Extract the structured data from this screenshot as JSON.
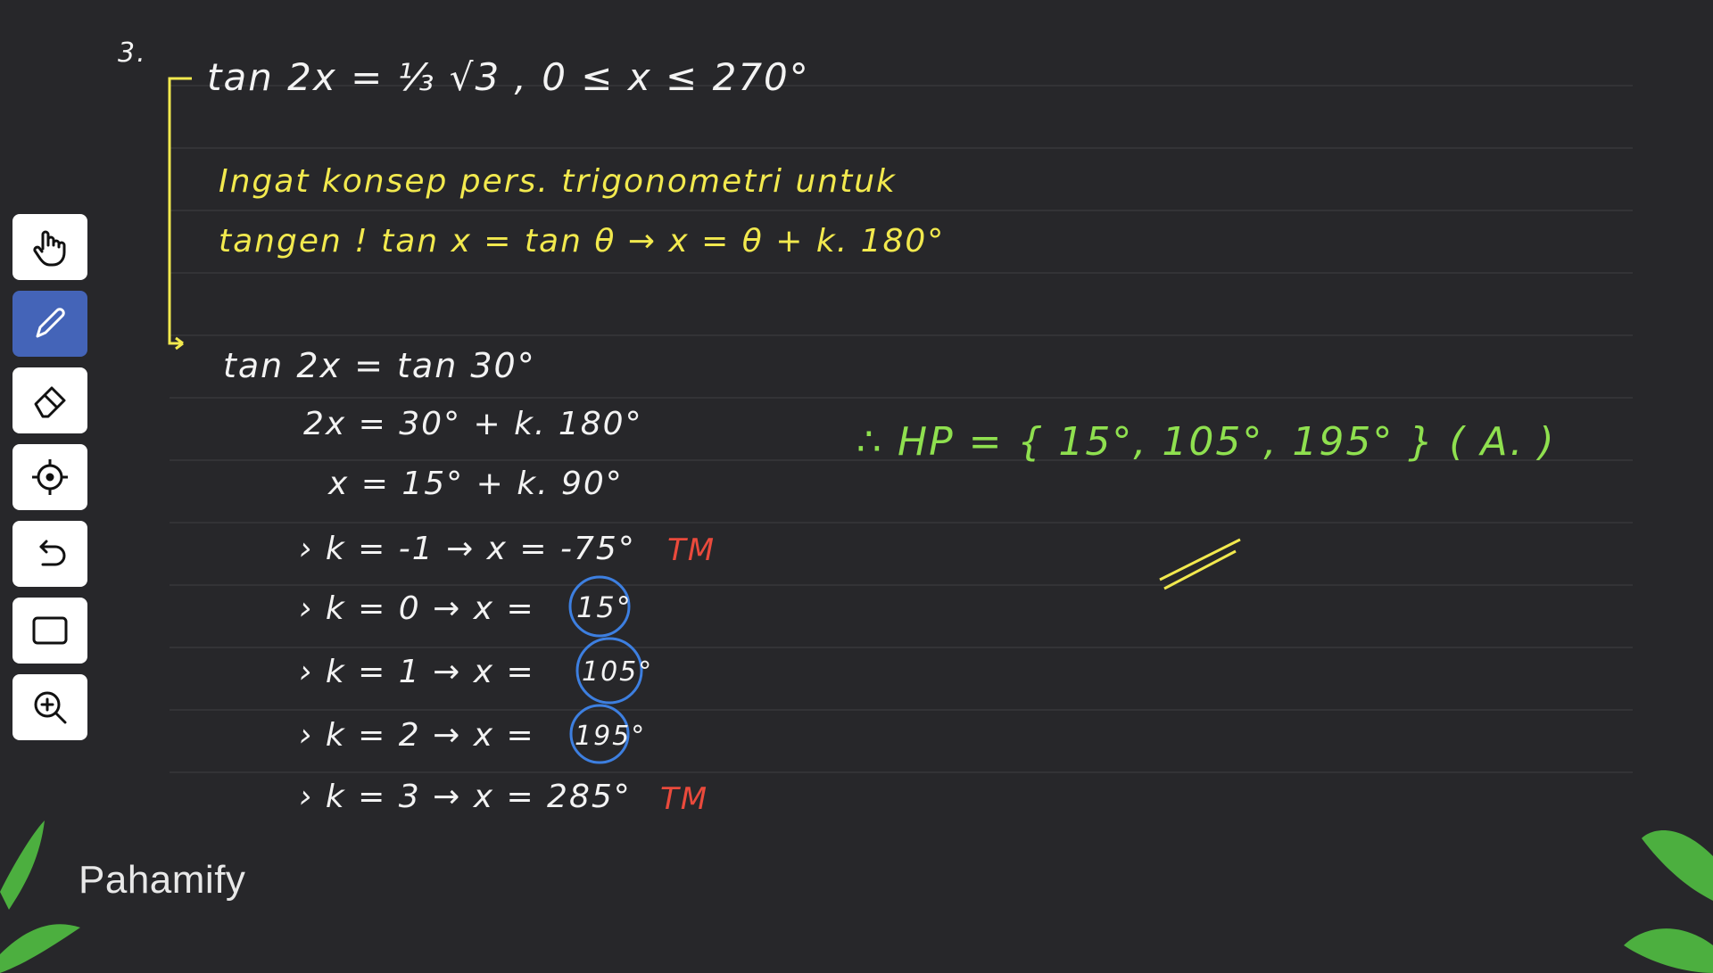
{
  "toolbar": {
    "tools": [
      {
        "name": "hand-tool",
        "icon": "hand-icon"
      },
      {
        "name": "pen-tool",
        "icon": "pen-icon",
        "active": true
      },
      {
        "name": "eraser-tool",
        "icon": "eraser-icon"
      },
      {
        "name": "pointer-tool",
        "icon": "crosshair-icon"
      },
      {
        "name": "undo-tool",
        "icon": "undo-icon"
      },
      {
        "name": "shape-tool",
        "icon": "rectangle-icon"
      },
      {
        "name": "zoom-tool",
        "icon": "zoom-in-icon"
      }
    ]
  },
  "notes": {
    "problem_number": "3.",
    "equation": "tan 2x = ⅓ √3 ,  0 ≤ x ≤ 270°",
    "hint_line1": "Ingat konsep pers. trigonometri untuk",
    "hint_line2": "tangen !  tan x = tan θ → x = θ + k. 180°",
    "step1": "tan 2x  =  tan 30°",
    "step2": "2x  =  30° + k. 180°",
    "step3": "x  =  15° + k. 90°",
    "case_m1": "› k = -1 → x = -75°",
    "case_m1_tag": "TM",
    "case_0_lhs": "› k = 0  →  x =",
    "case_0_val": "15°",
    "case_1_lhs": "› k = 1  →  x =",
    "case_1_val": "105°",
    "case_2_lhs": "› k = 2  →  x =",
    "case_2_val": "195°",
    "case_3": "› k = 3  →  x = 285°",
    "case_3_tag": "TM",
    "answer": "∴ HP = { 15°, 105°, 195° } ( A. )"
  },
  "brand": {
    "logo_text": "Pahamify"
  },
  "colors": {
    "background": "#27272a",
    "yellow_ink": "#f2e94e",
    "green_ink": "#8fe04f",
    "white_ink": "#f3f3f3",
    "red_ink": "#ea4a3c",
    "blue_ink": "#3d7fe0",
    "active_tool": "#4464b8"
  }
}
